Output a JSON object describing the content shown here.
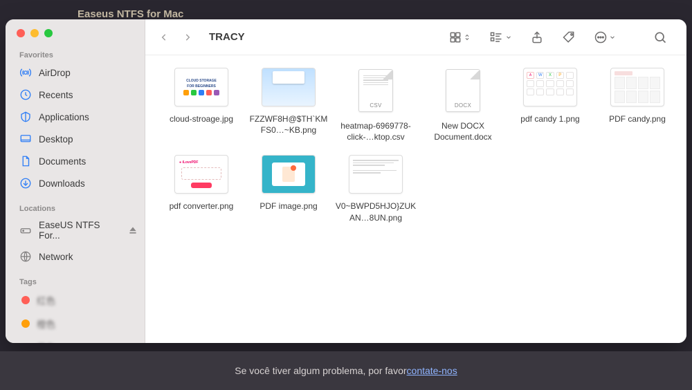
{
  "bg_app_title": "Easeus NTFS for Mac",
  "window": {
    "title": "TRACY",
    "traffic": [
      "close",
      "minimize",
      "fullscreen"
    ]
  },
  "sidebar": {
    "sections": [
      {
        "label": "Favorites",
        "items": [
          {
            "id": "airdrop",
            "label": "AirDrop",
            "icon": "airdrop"
          },
          {
            "id": "recents",
            "label": "Recents",
            "icon": "clock"
          },
          {
            "id": "applications",
            "label": "Applications",
            "icon": "apps"
          },
          {
            "id": "desktop",
            "label": "Desktop",
            "icon": "desktop"
          },
          {
            "id": "documents",
            "label": "Documents",
            "icon": "document"
          },
          {
            "id": "downloads",
            "label": "Downloads",
            "icon": "download"
          }
        ]
      },
      {
        "label": "Locations",
        "items": [
          {
            "id": "easeus",
            "label": "EaseUS NTFS For...",
            "icon": "drive",
            "eject": true,
            "gray": true
          },
          {
            "id": "network",
            "label": "Network",
            "icon": "globe",
            "gray": true
          }
        ]
      },
      {
        "label": "Tags",
        "items": [
          {
            "id": "tag-red",
            "label": "红色",
            "color": "#ff5f57"
          },
          {
            "id": "tag-orange",
            "label": "橙色",
            "color": "#ff9f0a"
          },
          {
            "id": "tag-yellow",
            "label": "黄色",
            "color": "#ffd60a"
          }
        ]
      }
    ]
  },
  "toolbar_icons": {
    "view": "icon-grid-view",
    "group": "group-by",
    "share": "share",
    "tag": "tag",
    "more": "more",
    "search": "search"
  },
  "files": [
    {
      "name": "cloud-stroage.jpg",
      "thumb": "cloud"
    },
    {
      "name": "FZZWF8H@$TH`KMFS0…~KB.png",
      "thumb": "windows"
    },
    {
      "name": "heatmap-6969778-click-…ktop.csv",
      "thumb": "doc",
      "ext": "CSV"
    },
    {
      "name": "New DOCX Document.docx",
      "thumb": "doc",
      "ext": "DOCX"
    },
    {
      "name": "pdf candy 1.png",
      "thumb": "pdfcandy1"
    },
    {
      "name": "PDF candy.png",
      "thumb": "pdfcandy2"
    },
    {
      "name": "pdf converter.png",
      "thumb": "conv"
    },
    {
      "name": "PDF image.png",
      "thumb": "pdfimg"
    },
    {
      "name": "V0~BWPD5HJO}ZUKAN…8UN.png",
      "thumb": "textdoc"
    }
  ],
  "footer": {
    "text": "Se você tiver algum problema, por favor ",
    "link": "contate-nos "
  }
}
